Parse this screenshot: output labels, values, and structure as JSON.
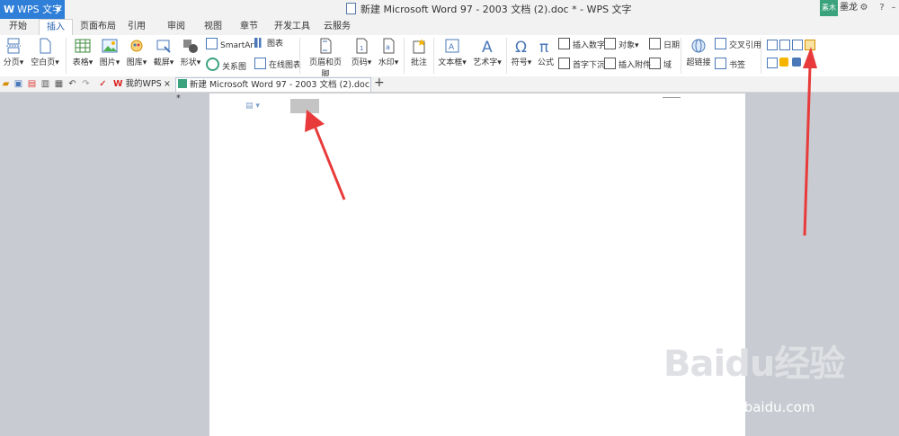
{
  "window": {
    "app_button": "WPS 文字",
    "title": "新建 Microsoft Word 97 - 2003 文档 (2).doc * - WPS 文字",
    "skin_badge": "素木",
    "user_name": "墨龙"
  },
  "ribbon_tabs": [
    {
      "label": "开始",
      "active": false
    },
    {
      "label": "插入",
      "active": true
    },
    {
      "label": "页面布局",
      "active": false
    },
    {
      "label": "引用",
      "active": false
    },
    {
      "label": "审阅",
      "active": false
    },
    {
      "label": "视图",
      "active": false
    },
    {
      "label": "章节",
      "active": false
    },
    {
      "label": "开发工具",
      "active": false
    },
    {
      "label": "云服务",
      "active": false
    }
  ],
  "ribbon": {
    "page_break": "分页",
    "blank_page": "空白页",
    "table": "表格",
    "picture": "图片",
    "gallery": "图库",
    "screenshot": "截屏",
    "shapes": "形状",
    "smartart": "SmartArt",
    "chart": "图表",
    "relation": "关系图",
    "online_chart": "在线图表",
    "header_footer": "页眉和页脚",
    "page_number": "页码",
    "watermark": "水印",
    "comment": "批注",
    "textbox": "文本框",
    "wordart": "艺术字",
    "symbol": "符号",
    "formula": "公式",
    "insert_number": "插入数字",
    "object": "对象",
    "date": "日期",
    "drop_cap": "首字下沉",
    "attachment": "插入附件",
    "field": "域",
    "hyperlink": "超链接",
    "cross_ref": "交叉引用",
    "bookmark": "书签"
  },
  "doc_tabs": [
    {
      "label": "我的WPS",
      "active": false
    },
    {
      "label": "新建 Microsoft Word 97 - 2003 文档 (2).doc *",
      "active": true
    }
  ],
  "watermark": {
    "brand": "Baidu经验",
    "url": "jingyan.baidu.com"
  },
  "colors": {
    "accent": "#2f7ed8",
    "annotation_arrow": "#e83a3a",
    "workspace": "#c8cbd1"
  }
}
